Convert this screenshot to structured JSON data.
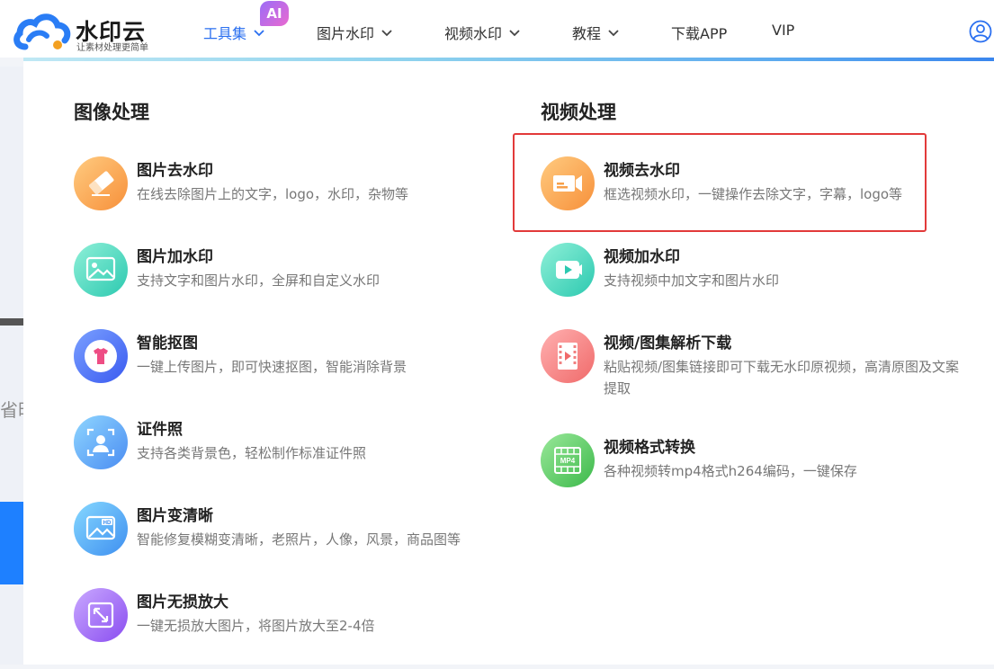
{
  "brand": {
    "name": "水印云",
    "slogan": "让素材处理更简单"
  },
  "nav": {
    "items": [
      {
        "label": "工具集",
        "active": true,
        "has_dropdown": true
      },
      {
        "label": "图片水印",
        "has_dropdown": true
      },
      {
        "label": "视频水印",
        "has_dropdown": true
      },
      {
        "label": "教程",
        "has_dropdown": true
      },
      {
        "label": "下载APP"
      },
      {
        "label": "VIP"
      }
    ],
    "ai_badge": "AI"
  },
  "background": {
    "partial_text": "省时"
  },
  "image_section": {
    "title": "图像处理",
    "tools": [
      {
        "name": "图片去水印",
        "desc": "在线去除图片上的文字，logo，水印，杂物等",
        "icon": "eraser-icon"
      },
      {
        "name": "图片加水印",
        "desc": "支持文字和图片水印，全屏和自定义水印",
        "icon": "picture-icon"
      },
      {
        "name": "智能抠图",
        "desc": "一键上传图片，即可快速抠图，智能消除背景",
        "icon": "cutout-shirt-icon"
      },
      {
        "name": "证件照",
        "desc": "支持各类背景色，轻松制作标准证件照",
        "icon": "id-photo-icon"
      },
      {
        "name": "图片变清晰",
        "desc": "智能修复模糊变清晰，老照片，人像，风景，商品图等",
        "icon": "hd-image-icon"
      },
      {
        "name": "图片无损放大",
        "desc": "一键无损放大图片，将图片放大至2-4倍",
        "icon": "enlarge-icon"
      }
    ]
  },
  "video_section": {
    "title": "视频处理",
    "tools": [
      {
        "name": "视频去水印",
        "desc": "框选视频水印，一键操作去除文字，字幕，logo等",
        "icon": "video-camera-icon",
        "highlighted": true
      },
      {
        "name": "视频加水印",
        "desc": "支持视频中加文字和图片水印",
        "icon": "video-play-icon"
      },
      {
        "name": "视频/图集解析下载",
        "desc": "粘贴视频/图集链接即可下载无水印原视频，高清原图及文案提取",
        "icon": "film-icon"
      },
      {
        "name": "视频格式转换",
        "desc": "各种视频转mp4格式h264编码，一键保存",
        "icon": "mp4-icon",
        "icon_text": "MP4"
      }
    ]
  },
  "colors": {
    "accent": "#2a6ff0",
    "highlight_border": "#e23a3a"
  }
}
